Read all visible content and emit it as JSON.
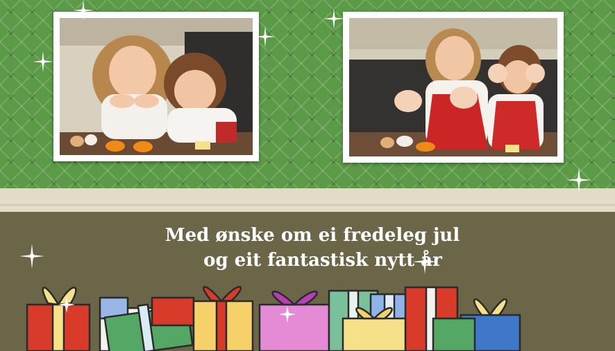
{
  "greeting": {
    "line1": "Med ønske om ei fredeleg jul",
    "line2": "og eit fantastisk nytt år"
  },
  "photos": [
    {
      "description_icon": "children-photo-icon"
    },
    {
      "description_icon": "children-photo-icon"
    }
  ],
  "colors": {
    "pattern_green": "#5b9a46",
    "band": "#e2dcc7",
    "bottom": "#6b6648",
    "text": "#ffffff"
  },
  "decor_icons": [
    "sparkle-icon",
    "gift-boxes-icon"
  ]
}
